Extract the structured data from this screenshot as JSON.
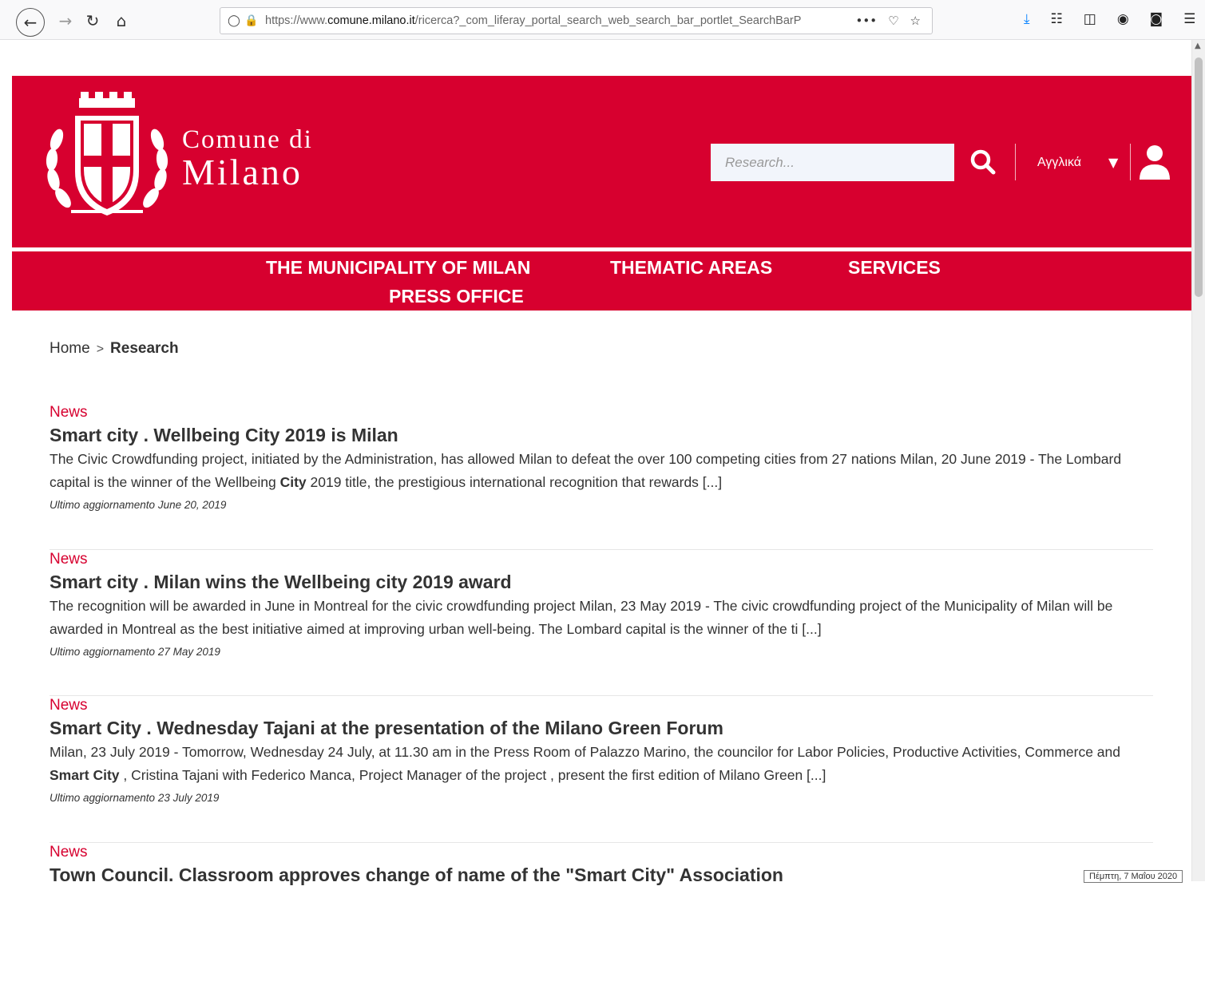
{
  "browser": {
    "url_prefix": "https://www.",
    "url_domain": "comune.milano.it",
    "url_rest": "/ricerca?_com_liferay_portal_search_web_search_bar_portlet_SearchBarP",
    "more_label": "•••"
  },
  "header": {
    "brand_small": "Comune di",
    "brand_big": "Milano",
    "search_placeholder": "Research...",
    "language": "Αγγλικά",
    "brand_color": "#d7002f"
  },
  "nav": {
    "items": [
      {
        "label": "THE MUNICIPALITY OF MILAN"
      },
      {
        "label": "THEMATIC AREAS"
      },
      {
        "label": "SERVICES"
      },
      {
        "label": "PRESS OFFICE"
      }
    ]
  },
  "breadcrumb": {
    "home": "Home",
    "separator": ">",
    "current": "Research"
  },
  "results": [
    {
      "category": "News",
      "title": "Smart city . Wellbeing City 2019 is Milan",
      "body_parts": [
        "The Civic Crowdfunding project, initiated by the Administration, has allowed Milan to defeat the over 100 competing cities from 27 nations Milan, 20 June 2019 - The Lombard capital is the winner of the Wellbeing ",
        "City",
        " 2019 title, the prestigious international recognition that rewards [...]"
      ],
      "date": "Ultimo aggiornamento June 20, 2019"
    },
    {
      "category": "News",
      "title": "Smart city . Milan wins the Wellbeing city 2019 award",
      "body_parts": [
        "The recognition will be awarded in June in Montreal for the civic crowdfunding project Milan, 23 May 2019 - The civic crowdfunding project of the Municipality of Milan will be awarded in Montreal as the best initiative aimed at improving urban well-being. The Lombard capital is the winner of the ti [...]",
        "",
        ""
      ],
      "date": "Ultimo aggiornamento 27 May 2019"
    },
    {
      "category": "News",
      "title": "Smart City . Wednesday Tajani at the presentation of the Milano Green Forum",
      "body_parts": [
        "Milan, 23 July 2019 - Tomorrow, Wednesday 24 July, at 11.30 am in the Press Room of Palazzo Marino, the councilor for Labor Policies, Productive Activities, Commerce and ",
        "Smart City",
        " , Cristina Tajani with Federico Manca, Project Manager of the project , present the first edition of Milano Green [...]"
      ],
      "date": "Ultimo aggiornamento 23 July 2019"
    },
    {
      "category": "News",
      "title": "Town Council. Classroom approves change of name of the \"Smart City\" Association",
      "body_parts": [
        "",
        "",
        ""
      ],
      "date": ""
    }
  ],
  "tooltip": "Πέμπτη, 7 Μαΐου 2020"
}
